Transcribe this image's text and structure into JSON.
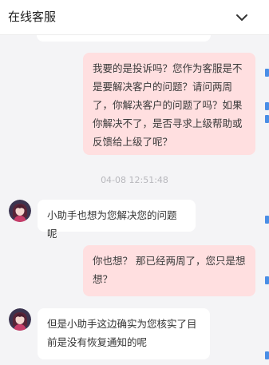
{
  "header": {
    "title": "在线客服",
    "collapse_icon": "chevron-down-icon"
  },
  "messages": [
    {
      "sender": "user",
      "text": "我要的是投诉吗？您作为客服是不是要解决客户的问题？请问两周了，你解决客户的问题了吗？如果你解决不了，是否寻求上级帮助或反馈给上级了呢？"
    },
    {
      "type": "timestamp",
      "text": "04-08 12:51:48"
    },
    {
      "sender": "agent",
      "text": "小助手也想为您解决您的问题呢"
    },
    {
      "sender": "user",
      "text": "你也想？  那已经两周了，您只是想想？"
    },
    {
      "sender": "agent",
      "text": "但是小助手这边确实为您核实了目前是没有恢复通知的呢"
    }
  ],
  "colors": {
    "user_bubble": "#ffdfe0",
    "agent_bubble": "#ffffff",
    "background": "#f4f4f6",
    "edge_accent": "#4a8ee6"
  },
  "agent": {
    "avatar_icon": "agent-avatar-icon"
  }
}
